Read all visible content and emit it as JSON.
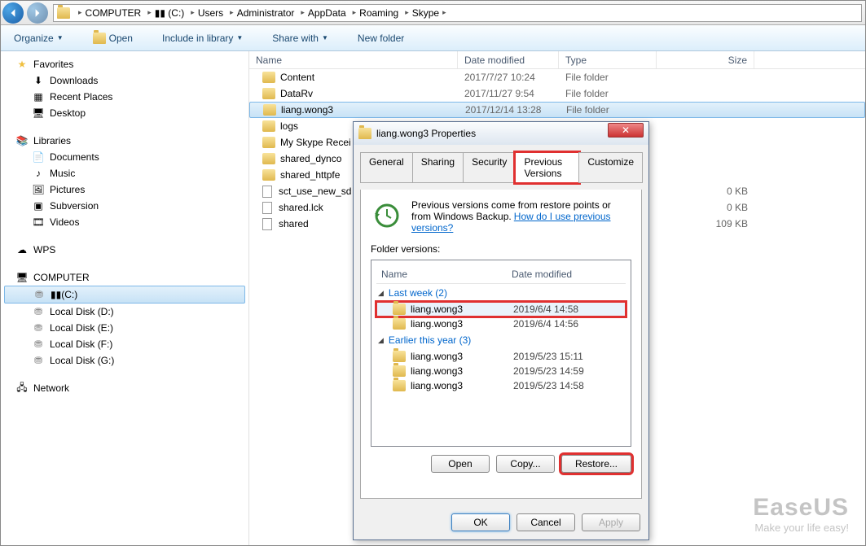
{
  "breadcrumb": [
    "COMPUTER",
    "(C:)",
    "Users",
    "Administrator",
    "AppData",
    "Roaming",
    "Skype"
  ],
  "toolbar": {
    "organize": "Organize",
    "open": "Open",
    "include": "Include in library",
    "share": "Share with",
    "newfolder": "New folder"
  },
  "sidebar": {
    "favorites": {
      "label": "Favorites",
      "items": [
        "Downloads",
        "Recent Places",
        "Desktop"
      ]
    },
    "libraries": {
      "label": "Libraries",
      "items": [
        "Documents",
        "Music",
        "Pictures",
        "Subversion",
        "Videos"
      ]
    },
    "wps": "WPS",
    "computer": {
      "label": "COMPUTER",
      "items": [
        "(C:)",
        "Local Disk (D:)",
        "Local Disk (E:)",
        "Local Disk (F:)",
        "Local Disk (G:)"
      ]
    },
    "network": "Network"
  },
  "columns": {
    "name": "Name",
    "date": "Date modified",
    "type": "Type",
    "size": "Size"
  },
  "files": [
    {
      "name": "Content",
      "date": "2017/7/27 10:24",
      "type": "File folder",
      "size": "",
      "icon": "folder"
    },
    {
      "name": "DataRv",
      "date": "2017/11/27 9:54",
      "type": "File folder",
      "size": "",
      "icon": "folder"
    },
    {
      "name": "liang.wong3",
      "date": "2017/12/14 13:28",
      "type": "File folder",
      "size": "",
      "icon": "folder",
      "selected": true
    },
    {
      "name": "logs",
      "date": "",
      "type": "",
      "size": "",
      "icon": "folder"
    },
    {
      "name": "My Skype Recei",
      "date": "",
      "type": "",
      "size": "",
      "icon": "folder"
    },
    {
      "name": "shared_dynco",
      "date": "",
      "type": "",
      "size": "",
      "icon": "folder"
    },
    {
      "name": "shared_httpfe",
      "date": "",
      "type": "",
      "size": "",
      "icon": "folder"
    },
    {
      "name": "sct_use_new_sd",
      "date": "",
      "type": "",
      "size": "0 KB",
      "icon": "doc"
    },
    {
      "name": "shared.lck",
      "date": "",
      "type": "",
      "size": "0 KB",
      "icon": "doc"
    },
    {
      "name": "shared",
      "date": "",
      "type": "",
      "size": "109 KB",
      "icon": "doc"
    }
  ],
  "dialog": {
    "title": "liang.wong3 Properties",
    "tabs": [
      "General",
      "Sharing",
      "Security",
      "Previous Versions",
      "Customize"
    ],
    "info": "Previous versions come from restore points or from Windows Backup.",
    "info_link": "How do I use previous versions?",
    "versions_label": "Folder versions:",
    "col_name": "Name",
    "col_date": "Date modified",
    "groups": [
      {
        "label": "Last week (2)",
        "items": [
          {
            "name": "liang.wong3",
            "date": "2019/6/4 14:58",
            "highlight": true
          },
          {
            "name": "liang.wong3",
            "date": "2019/6/4 14:56"
          }
        ]
      },
      {
        "label": "Earlier this year (3)",
        "items": [
          {
            "name": "liang.wong3",
            "date": "2019/5/23 15:11"
          },
          {
            "name": "liang.wong3",
            "date": "2019/5/23 14:59"
          },
          {
            "name": "liang.wong3",
            "date": "2019/5/23 14:58"
          }
        ]
      }
    ],
    "open": "Open",
    "copy": "Copy...",
    "restore": "Restore...",
    "ok": "OK",
    "cancel": "Cancel",
    "apply": "Apply"
  },
  "watermark": {
    "brand": "EaseUS",
    "slogan": "Make your life easy!"
  }
}
